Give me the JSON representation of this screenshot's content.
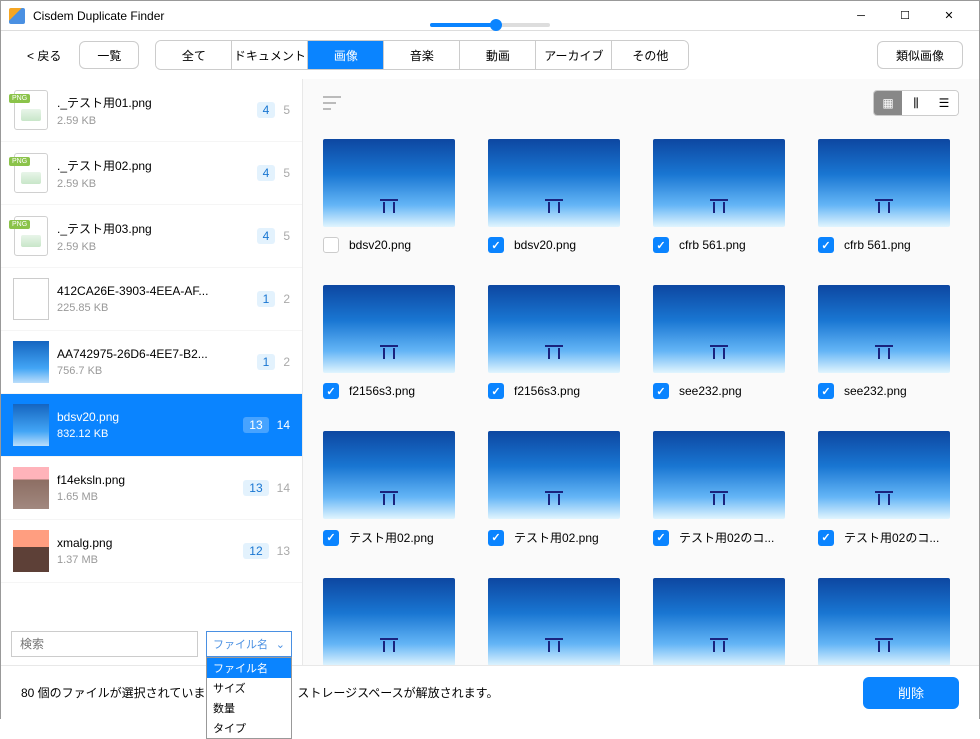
{
  "window": {
    "title": "Cisdem Duplicate Finder"
  },
  "toolbar": {
    "back": "< 戻る",
    "list": "一覧",
    "similar": "類似画像",
    "tabs": [
      "全て",
      "ドキュメント",
      "画像",
      "音楽",
      "動画",
      "アーカイブ",
      "その他"
    ],
    "active_tab": 2
  },
  "sidebar": {
    "items": [
      {
        "thumb": "png",
        "name": "._テスト用01.png",
        "size": "2.59 KB",
        "c1": "4",
        "c2": "5"
      },
      {
        "thumb": "png",
        "name": "._テスト用02.png",
        "size": "2.59 KB",
        "c1": "4",
        "c2": "5"
      },
      {
        "thumb": "png",
        "name": "._テスト用03.png",
        "size": "2.59 KB",
        "c1": "4",
        "c2": "5"
      },
      {
        "thumb": "doc",
        "name": "412CA26E-3903-4EEA-AF...",
        "size": "225.85 KB",
        "c1": "1",
        "c2": "2"
      },
      {
        "thumb": "sky",
        "name": "AA742975-26D6-4EE7-B2...",
        "size": "756.7 KB",
        "c1": "1",
        "c2": "2"
      },
      {
        "thumb": "sky",
        "name": "bdsv20.png",
        "size": "832.12 KB",
        "c1": "13",
        "c2": "14",
        "selected": true
      },
      {
        "thumb": "photo",
        "name": "f14eksln.png",
        "size": "1.65 MB",
        "c1": "13",
        "c2": "14"
      },
      {
        "thumb": "sunset",
        "name": "xmalg.png",
        "size": "1.37 MB",
        "c1": "12",
        "c2": "13"
      }
    ],
    "search_placeholder": "検索",
    "sort": {
      "selected": "ファイル名",
      "options": [
        "ファイル名",
        "サイズ",
        "数量",
        "タイプ"
      ]
    }
  },
  "grid": {
    "items": [
      {
        "name": "bdsv20.png",
        "chk": false
      },
      {
        "name": "bdsv20.png",
        "chk": true
      },
      {
        "name": "cfrb 561.png",
        "chk": true
      },
      {
        "name": "cfrb 561.png",
        "chk": true
      },
      {
        "name": "f2156s3.png",
        "chk": true
      },
      {
        "name": "f2156s3.png",
        "chk": true
      },
      {
        "name": "see232.png",
        "chk": true
      },
      {
        "name": "see232.png",
        "chk": true
      },
      {
        "name": "テスト用02.png",
        "chk": true
      },
      {
        "name": "テスト用02.png",
        "chk": true
      },
      {
        "name": "テスト用02のコ...",
        "chk": true
      },
      {
        "name": "テスト用02のコ...",
        "chk": true
      },
      {
        "name": "",
        "chk": true,
        "noname": true
      },
      {
        "name": "",
        "chk": true,
        "noname": true
      },
      {
        "name": "",
        "chk": true,
        "noname": true
      },
      {
        "name": "",
        "chk": true,
        "noname": true
      }
    ]
  },
  "footer": {
    "status": "80 個のファイルが選択されています",
    "extra": "ストレージスペースが解放されます。",
    "delete": "削除"
  }
}
